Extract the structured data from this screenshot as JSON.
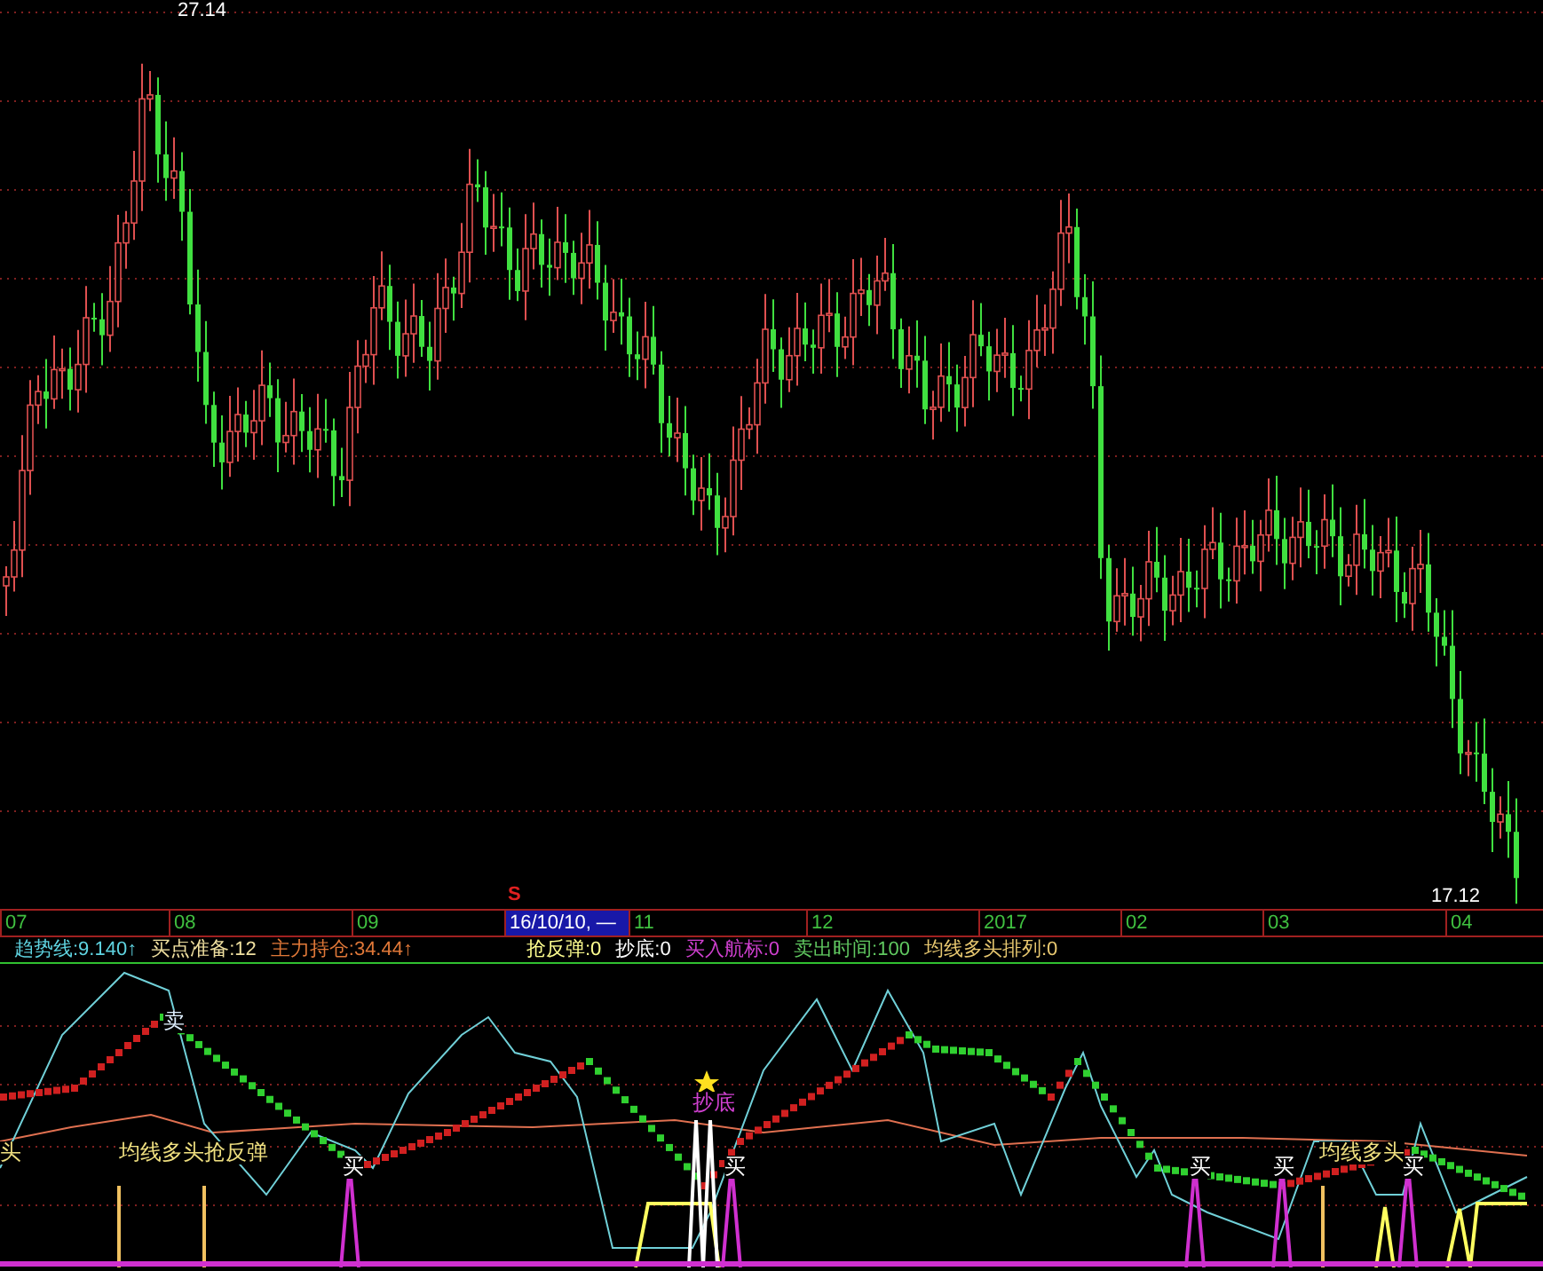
{
  "price_chart": {
    "high_label": "27.14",
    "low_label": "17.12"
  },
  "time_axis": {
    "marker": "S",
    "ticks": [
      {
        "label": "07",
        "selected": false
      },
      {
        "label": "08",
        "selected": false
      },
      {
        "label": "09",
        "selected": false
      },
      {
        "label": "16/10/10, —",
        "selected": true
      },
      {
        "label": "11",
        "selected": false
      },
      {
        "label": "12",
        "selected": false
      },
      {
        "label": "2017",
        "selected": false
      },
      {
        "label": "02",
        "selected": false
      },
      {
        "label": "03",
        "selected": false
      },
      {
        "label": "04",
        "selected": false
      }
    ]
  },
  "indicator_header": {
    "items": [
      {
        "label": "趋势线:9.140↑"
      },
      {
        "label": "买点准备:12"
      },
      {
        "label": "主力持仓:34.44↑"
      },
      {
        "label": "抢反弹:0"
      },
      {
        "label": "抄底:0"
      },
      {
        "label": "买入航标:0"
      },
      {
        "label": "卖出时间:100"
      },
      {
        "label": "均线多头排列:0"
      }
    ]
  },
  "signals": [
    {
      "text": "头",
      "kind": "pattern"
    },
    {
      "text": "卖",
      "kind": "sell"
    },
    {
      "text": "均线多头抢反弹",
      "kind": "pattern"
    },
    {
      "text": "买",
      "kind": "buy"
    },
    {
      "text": "抄底",
      "kind": "bottom"
    },
    {
      "text": "买",
      "kind": "buy"
    },
    {
      "text": "买",
      "kind": "buy"
    },
    {
      "text": "买",
      "kind": "buy"
    },
    {
      "text": "均线多头",
      "kind": "pattern"
    },
    {
      "text": "买",
      "kind": "buy"
    }
  ]
}
